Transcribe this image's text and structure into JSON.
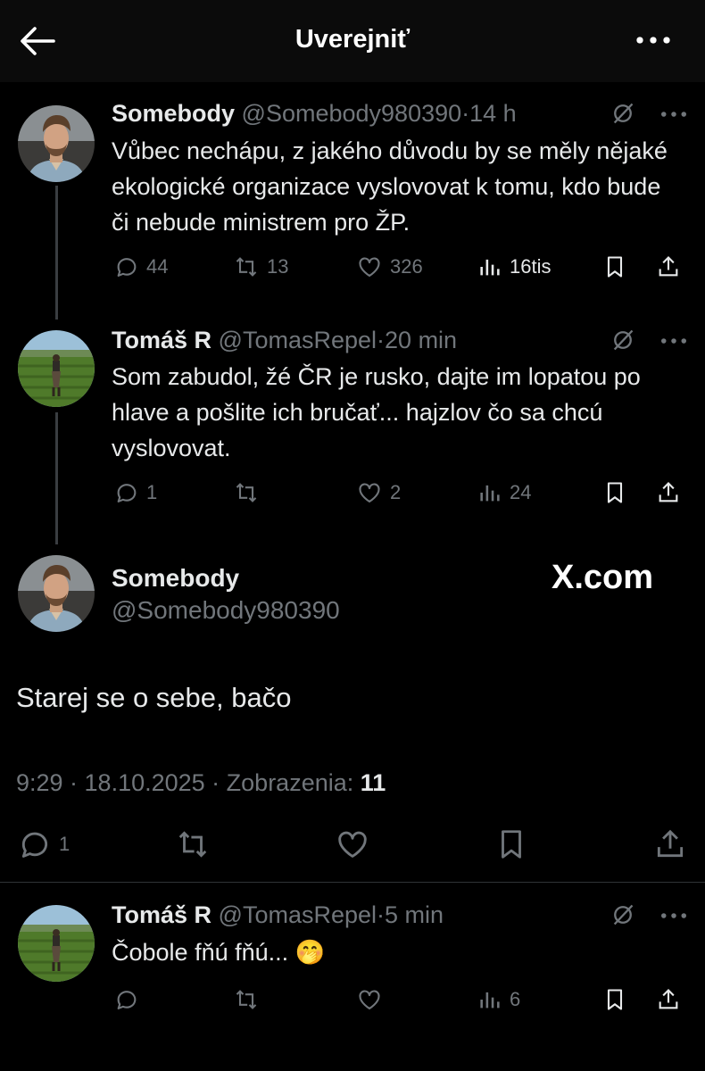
{
  "header": {
    "title": "Uverejniť"
  },
  "tweets": [
    {
      "name": "Somebody",
      "handle": "@Somebody980390",
      "sep": "·",
      "time": "14 h",
      "text": "Vůbec nechápu, z jakého důvodu by se měly nějaké ekologické organizace vyslovovat k tomu, kdo bude či nebude ministrem pro ŽP.",
      "replies": "44",
      "reposts": "13",
      "likes": "326",
      "views": "16tis"
    },
    {
      "name": "Tomáš R",
      "handle": "@TomasRepel",
      "sep": "·",
      "time": "20 min",
      "text": "Som zabudol, žé ČR je rusko, dajte im lopatou po hlave a pošlite ich bručať... hajzlov čo sa chcú vyslovovat.",
      "replies": "1",
      "reposts": "",
      "likes": "2",
      "views": "24"
    }
  ],
  "focus": {
    "name": "Somebody",
    "handle": "@Somebody980390",
    "watermark": "X.com",
    "text": "Starej se o sebe, bačo",
    "meta_prefix": "9:29 · 18.10.2025 · Zobrazenia: ",
    "views": "11",
    "replies": "1"
  },
  "reply": {
    "name": "Tomáš R",
    "handle": "@TomasRepel",
    "sep": "·",
    "time": "5 min",
    "text": "Čobole fňú fňú... 🤭",
    "views": "6"
  },
  "colors": {
    "background": "#000000",
    "text": "#e7e9ea",
    "muted": "#71767b",
    "divider": "#2f3336"
  },
  "icons": [
    "back-arrow-icon",
    "more-dots-icon",
    "grok-icon",
    "reply-icon",
    "repost-icon",
    "like-icon",
    "views-icon",
    "bookmark-icon",
    "share-icon"
  ]
}
